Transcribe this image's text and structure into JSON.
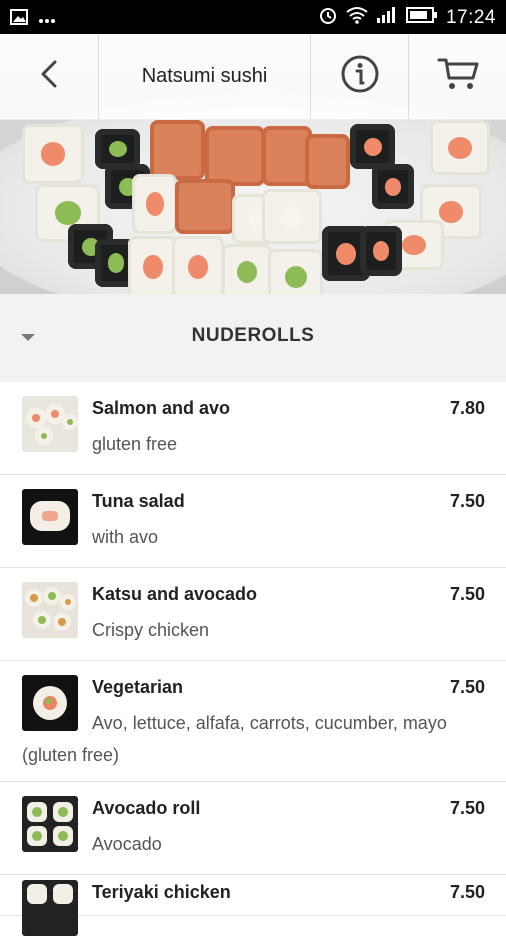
{
  "status_bar": {
    "time": "17:24",
    "icons": [
      "image-icon",
      "more-icon",
      "alarm-icon",
      "wifi-icon",
      "signal-icon",
      "battery-icon"
    ]
  },
  "header": {
    "title": "Natsumi sushi",
    "back_icon": "back-chevron-icon",
    "info_icon": "info-icon",
    "cart_icon": "cart-icon"
  },
  "section": {
    "title": "NUDEROLLS",
    "expand_icon": "caret-down-icon"
  },
  "items": [
    {
      "name": "Salmon and avo",
      "description": "gluten free",
      "price": "7.80"
    },
    {
      "name": "Tuna salad",
      "description": "with avo",
      "price": "7.50"
    },
    {
      "name": "Katsu and avocado",
      "description": "Crispy chicken",
      "price": "7.50"
    },
    {
      "name": "Vegetarian",
      "description": "Avo, lettuce, alfafa, carrots, cucumber, mayo (gluten free)",
      "price": "7.50"
    },
    {
      "name": "Avocado roll",
      "description": "Avocado",
      "price": "7.50"
    },
    {
      "name": "Teriyaki chicken",
      "description": "",
      "price": "7.50"
    }
  ],
  "colors": {
    "status_bar": "#000000",
    "section_bg": "#f2f2f2",
    "divider": "#e2e2e2"
  }
}
